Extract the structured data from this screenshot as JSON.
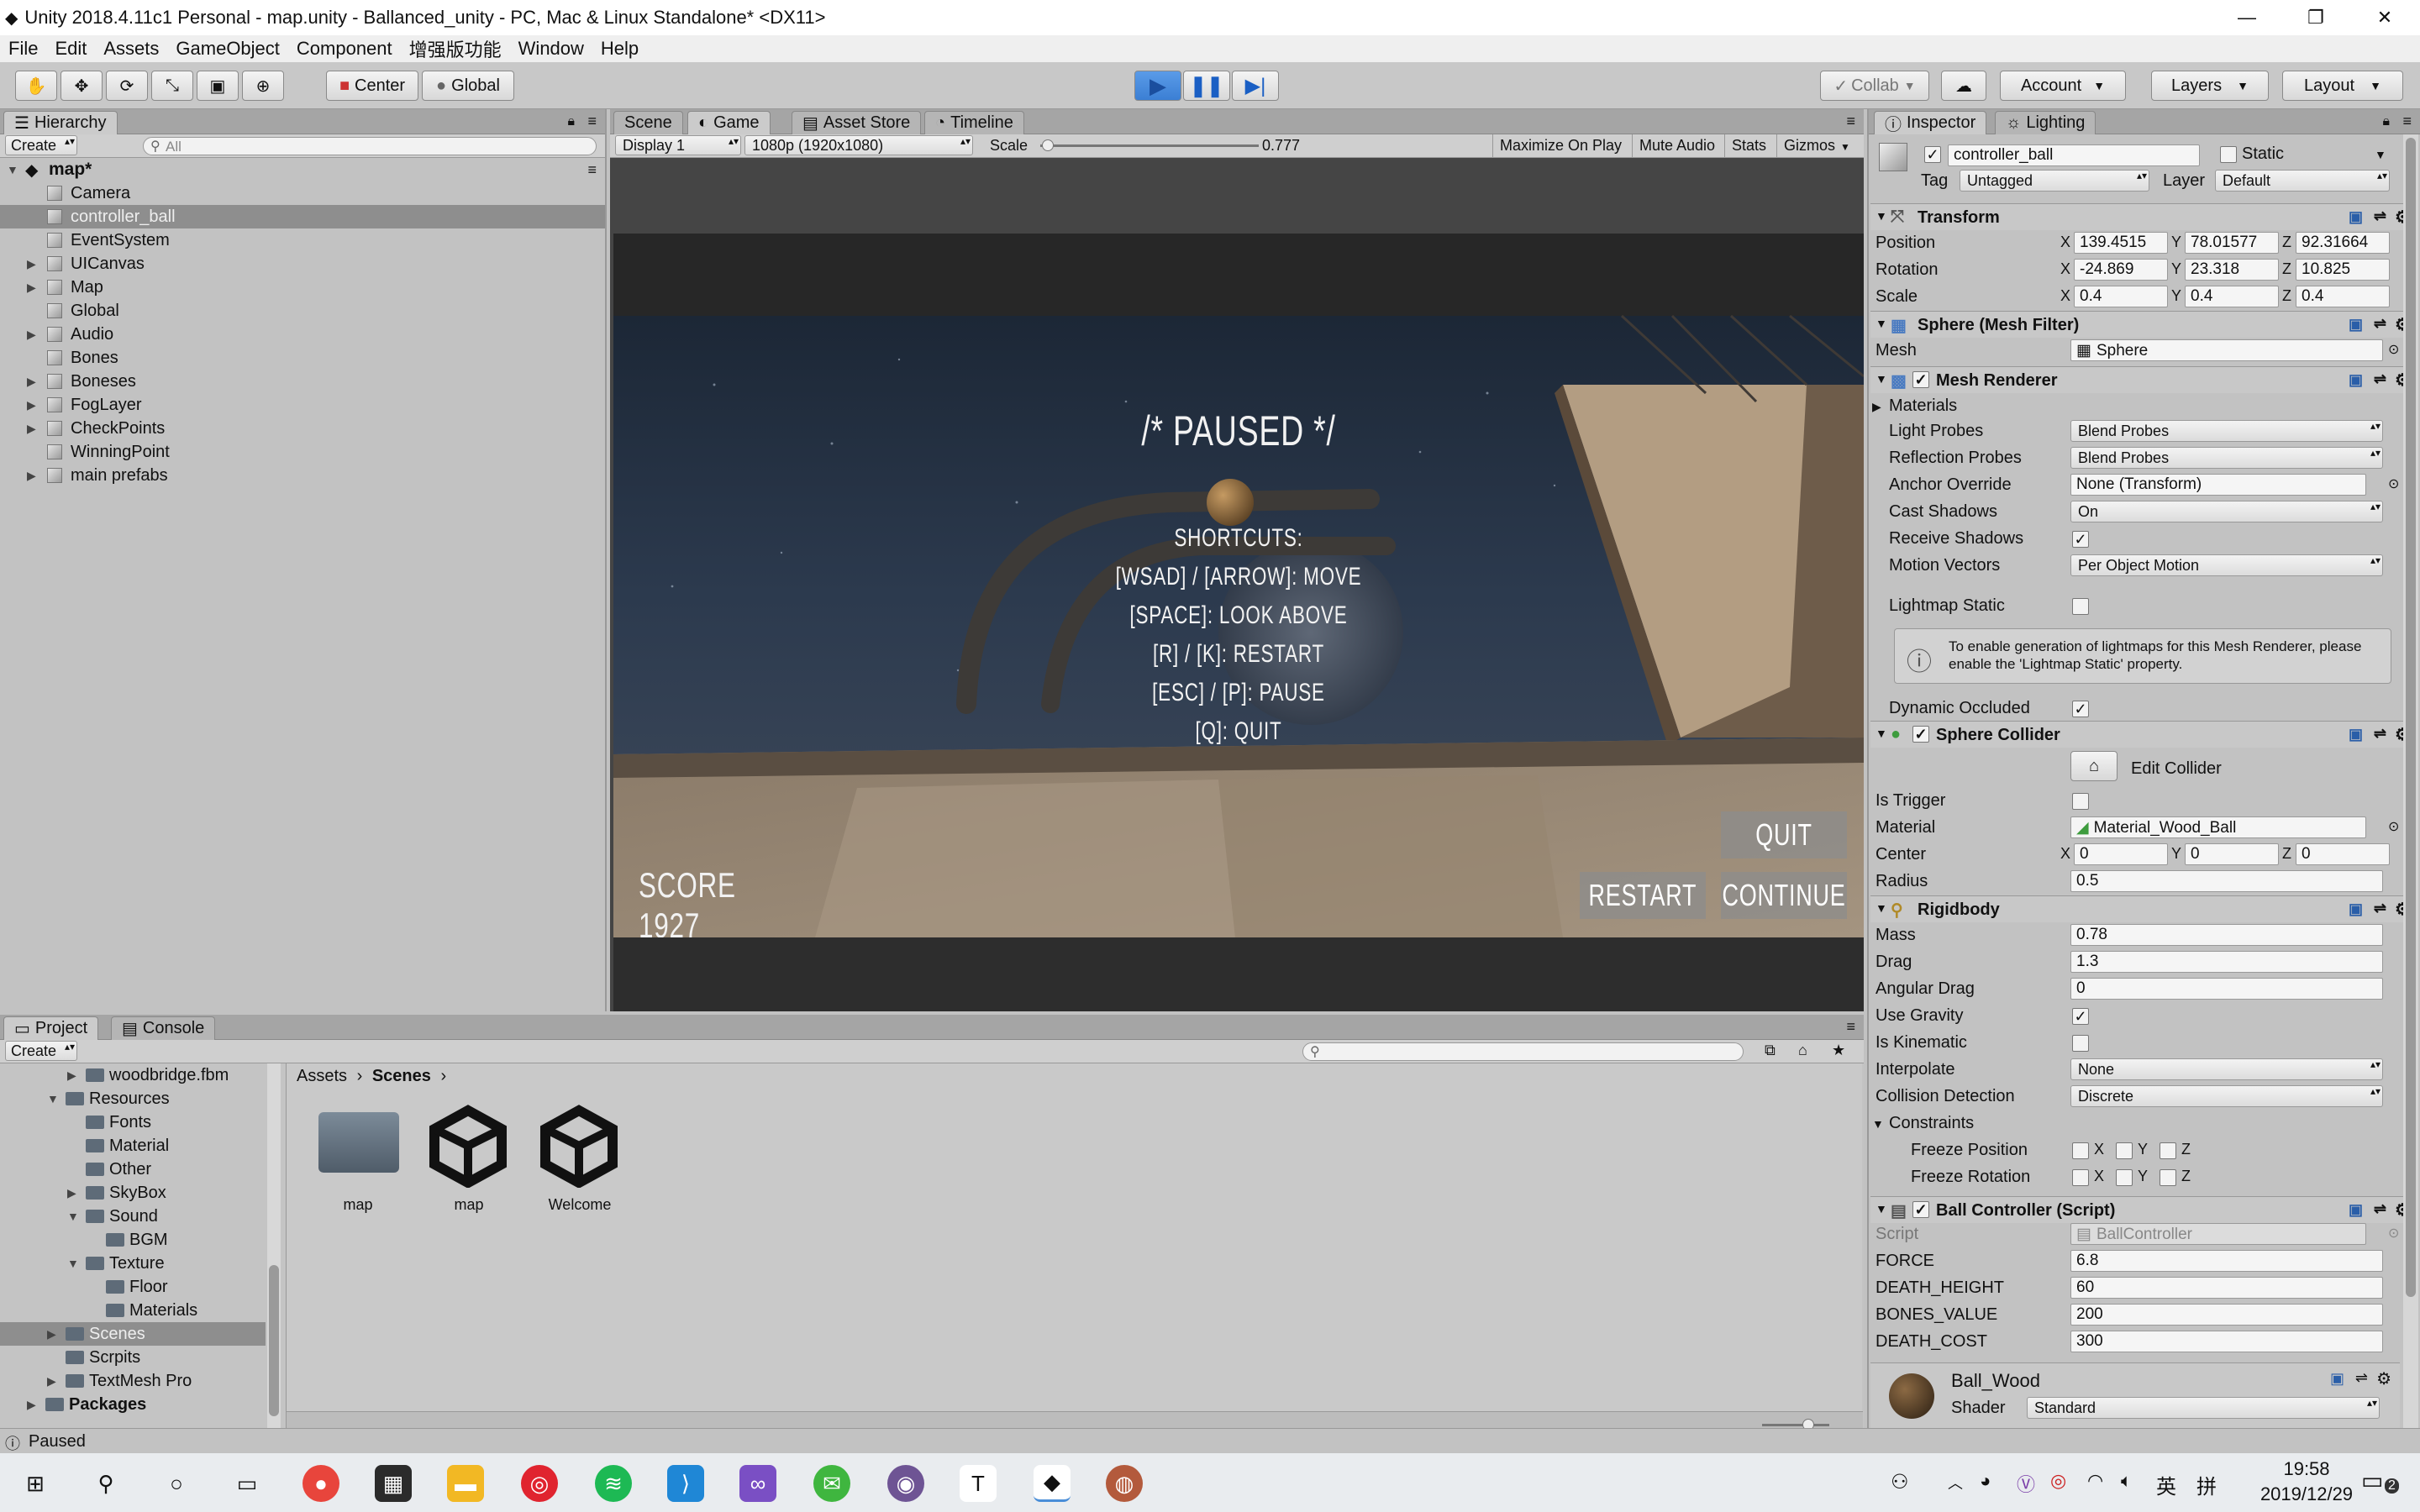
{
  "window": {
    "title": "Unity 2018.4.11c1 Personal - map.unity - Ballanced_unity - PC, Mac & Linux Standalone* <DX11>",
    "controls": [
      "—",
      "❐",
      "✕"
    ]
  },
  "menu": [
    "File",
    "Edit",
    "Assets",
    "GameObject",
    "Component",
    "增强版功能",
    "Window",
    "Help"
  ],
  "toolbar": {
    "pivot_center": "Center",
    "pivot_global": "Global",
    "collab": "Collab",
    "account": "Account",
    "layers": "Layers",
    "layout": "Layout"
  },
  "hierarchy": {
    "tab": "Hierarchy",
    "create": "Create",
    "search_placeholder": "All",
    "scene": "map*",
    "items": [
      {
        "label": "Camera",
        "expandable": false,
        "selected": false
      },
      {
        "label": "controller_ball",
        "expandable": false,
        "selected": true
      },
      {
        "label": "EventSystem",
        "expandable": false,
        "selected": false
      },
      {
        "label": "UICanvas",
        "expandable": true,
        "selected": false
      },
      {
        "label": "Map",
        "expandable": true,
        "selected": false
      },
      {
        "label": "Global",
        "expandable": false,
        "selected": false
      },
      {
        "label": "Audio",
        "expandable": true,
        "selected": false
      },
      {
        "label": "Bones",
        "expandable": false,
        "selected": false
      },
      {
        "label": "Boneses",
        "expandable": true,
        "selected": false
      },
      {
        "label": "FogLayer",
        "expandable": true,
        "selected": false
      },
      {
        "label": "CheckPoints",
        "expandable": true,
        "selected": false
      },
      {
        "label": "WinningPoint",
        "expandable": false,
        "selected": false
      },
      {
        "label": "main prefabs",
        "expandable": true,
        "selected": false
      }
    ]
  },
  "view_tabs": [
    "Scene",
    "Game",
    "Asset Store",
    "Timeline"
  ],
  "game_bar": {
    "display": "Display 1",
    "resolution": "1080p (1920x1080)",
    "scale_label": "Scale",
    "scale_value": "0.777",
    "scale_fraction": 0.4,
    "maximize": "Maximize On Play",
    "mute": "Mute Audio",
    "stats": "Stats",
    "gizmos": "Gizmos"
  },
  "game": {
    "paused_title": "/* PAUSED */",
    "shortcuts_header": "SHORTCUTS:",
    "shortcuts": [
      "[WSAD] / [ARROW]: MOVE",
      "[SPACE]: LOOK ABOVE",
      "[R] / [K]: RESTART",
      "[ESC] / [P]: PAUSE",
      "[Q]: QUIT"
    ],
    "score": "SCORE 1927",
    "quit": "QUIT",
    "restart": "RESTART",
    "continue": "CONTINUE"
  },
  "project": {
    "tabs": [
      "Project",
      "Console"
    ],
    "create": "Create",
    "tree": [
      {
        "label": "woodbridge.fbm",
        "indent": 2,
        "arrow": "right"
      },
      {
        "label": "Resources",
        "indent": 1,
        "arrow": "down"
      },
      {
        "label": "Fonts",
        "indent": 2,
        "arrow": ""
      },
      {
        "label": "Material",
        "indent": 2,
        "arrow": ""
      },
      {
        "label": "Other",
        "indent": 2,
        "arrow": ""
      },
      {
        "label": "SkyBox",
        "indent": 2,
        "arrow": "right"
      },
      {
        "label": "Sound",
        "indent": 2,
        "arrow": "down"
      },
      {
        "label": "BGM",
        "indent": 3,
        "arrow": ""
      },
      {
        "label": "Texture",
        "indent": 2,
        "arrow": "down"
      },
      {
        "label": "Floor",
        "indent": 3,
        "arrow": ""
      },
      {
        "label": "Materials",
        "indent": 3,
        "arrow": ""
      },
      {
        "label": "Scenes",
        "indent": 1,
        "arrow": "right",
        "selected": true
      },
      {
        "label": "Scrpits",
        "indent": 1,
        "arrow": ""
      },
      {
        "label": "TextMesh Pro",
        "indent": 1,
        "arrow": "right"
      },
      {
        "label": "Packages",
        "indent": 0,
        "arrow": "right",
        "bold": true
      }
    ],
    "breadcrumb": [
      "Assets",
      "Scenes"
    ],
    "assets": [
      {
        "label": "map",
        "kind": "folder"
      },
      {
        "label": "map",
        "kind": "unity"
      },
      {
        "label": "Welcome",
        "kind": "unity"
      }
    ]
  },
  "status": "Paused",
  "inspector": {
    "tabs": [
      "Inspector",
      "Lighting"
    ],
    "object_name": "controller_ball",
    "static_label": "Static",
    "tag_label": "Tag",
    "tag": "Untagged",
    "layer_label": "Layer",
    "layer": "Default",
    "transform": {
      "title": "Transform",
      "position_label": "Position",
      "position": [
        "139.4515",
        "78.01577",
        "92.31664"
      ],
      "rotation_label": "Rotation",
      "rotation": [
        "-24.869",
        "23.318",
        "10.825"
      ],
      "scale_label": "Scale",
      "scale": [
        "0.4",
        "0.4",
        "0.4"
      ]
    },
    "mesh_filter": {
      "title": "Sphere (Mesh Filter)",
      "mesh_label": "Mesh",
      "mesh": "Sphere"
    },
    "mesh_renderer": {
      "title": "Mesh Renderer",
      "materials_label": "Materials",
      "light_probes_label": "Light Probes",
      "light_probes": "Blend Probes",
      "reflection_probes_label": "Reflection Probes",
      "reflection_probes": "Blend Probes",
      "anchor_override_label": "Anchor Override",
      "anchor_override": "None (Transform)",
      "cast_shadows_label": "Cast Shadows",
      "cast_shadows": "On",
      "receive_shadows_label": "Receive Shadows",
      "motion_vectors_label": "Motion Vectors",
      "motion_vectors": "Per Object Motion",
      "lightmap_static_label": "Lightmap Static",
      "info": "To enable generation of lightmaps for this Mesh Renderer, please enable the 'Lightmap Static' property.",
      "dynamic_occluded_label": "Dynamic Occluded"
    },
    "sphere_collider": {
      "title": "Sphere Collider",
      "edit_collider": "Edit Collider",
      "is_trigger_label": "Is Trigger",
      "material_label": "Material",
      "material": "Material_Wood_Ball",
      "center_label": "Center",
      "center": [
        "0",
        "0",
        "0"
      ],
      "radius_label": "Radius",
      "radius": "0.5"
    },
    "rigidbody": {
      "title": "Rigidbody",
      "mass_label": "Mass",
      "mass": "0.78",
      "drag_label": "Drag",
      "drag": "1.3",
      "angular_drag_label": "Angular Drag",
      "angular_drag": "0",
      "use_gravity_label": "Use Gravity",
      "is_kinematic_label": "Is Kinematic",
      "interpolate_label": "Interpolate",
      "interpolate": "None",
      "collision_label": "Collision Detection",
      "collision": "Discrete",
      "constraints_label": "Constraints",
      "freeze_position_label": "Freeze Position",
      "freeze_rotation_label": "Freeze Rotation"
    },
    "ball_controller": {
      "title": "Ball Controller (Script)",
      "script_label": "Script",
      "script": "BallController",
      "force_label": "FORCE",
      "force": "6.8",
      "death_height_label": "DEATH_HEIGHT",
      "death_height": "60",
      "bones_value_label": "BONES_VALUE",
      "bones_value": "200",
      "death_cost_label": "DEATH_COST",
      "death_cost": "300"
    },
    "material_preview": {
      "name": "Ball_Wood",
      "shader_label": "Shader",
      "shader": "Standard"
    }
  },
  "axes": [
    "X",
    "Y",
    "Z"
  ],
  "taskbar": {
    "ime": "英",
    "ime2": "拼",
    "time": "19:58",
    "date": "2019/12/29",
    "notifications": "2"
  }
}
